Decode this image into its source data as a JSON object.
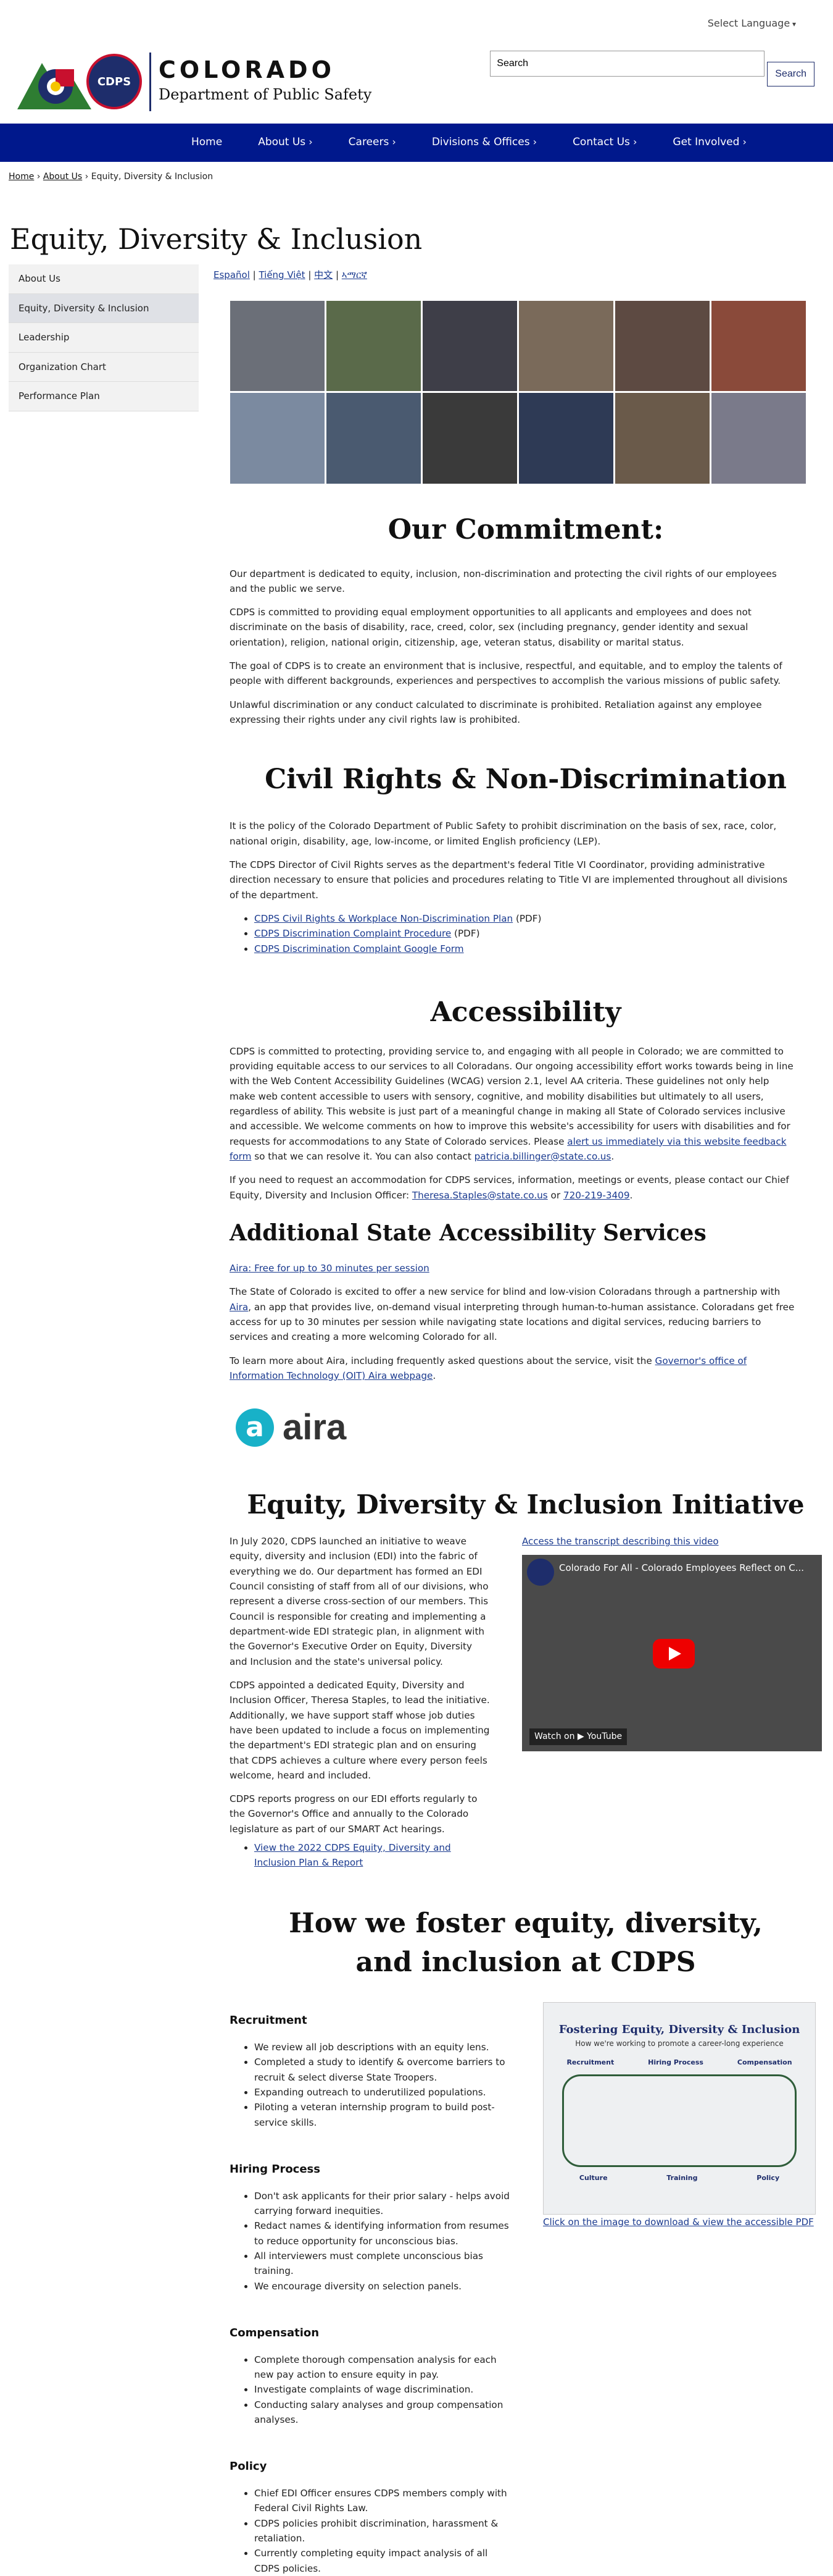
{
  "header": {
    "language_select": "Select Language",
    "logo_state": "COLORADO",
    "logo_dept": "Department of Public Safety",
    "logo_badge": "CDPS",
    "search_value": "Search",
    "search_button": "Search"
  },
  "nav": [
    "Home",
    "About Us",
    "Careers",
    "Divisions & Offices",
    "Contact Us",
    "Get Involved"
  ],
  "breadcrumb": {
    "home": "Home",
    "about": "About Us",
    "current": "Equity, Diversity & Inclusion"
  },
  "page_title": "Equity, Diversity & Inclusion",
  "sidebar": [
    "About Us",
    "Equity, Diversity & Inclusion",
    "Leadership",
    "Organization Chart",
    "Performance Plan"
  ],
  "languages": [
    "Español",
    "Tiếng Việt",
    "中文",
    "ኣማርኛ"
  ],
  "commitment": {
    "title": "Our Commitment:",
    "p1": "Our department is dedicated to equity, inclusion, non-discrimination and protecting the civil rights of our employees and the public we serve.",
    "p2": "CDPS is committed to providing equal employment opportunities to all applicants and employees and does not discriminate on the basis of disability, race, creed, color, sex (including pregnancy, gender identity and sexual orientation), religion, national origin, citizenship, age, veteran status, disability or marital status.",
    "p3": "The goal of CDPS is to create an environment that is inclusive, respectful, and equitable, and to employ the talents of people with different backgrounds, experiences and perspectives to accomplish the various missions of public safety.",
    "p4": "Unlawful discrimination or any conduct calculated to discriminate is prohibited. Retaliation against any employee expressing their rights under any civil rights law is prohibited."
  },
  "civil": {
    "title": "Civil Rights & Non-Discrimination",
    "p1": "It is the policy of the Colorado Department of Public Safety to prohibit discrimination on the basis of sex, race, color, national origin, disability, age, low-income, or limited English proficiency (LEP).",
    "p2": "The CDPS Director of Civil Rights serves as the department's federal Title VI Coordinator, providing administrative direction necessary to ensure that policies and procedures relating to Title VI are implemented throughout all divisions of the department.",
    "links": [
      {
        "text": "CDPS Civil Rights & Workplace Non-Discrimination Plan",
        "suffix": " (PDF)"
      },
      {
        "text": "CDPS Discrimination Complaint Procedure",
        "suffix": " (PDF)"
      },
      {
        "text": "CDPS Discrimination Complaint Google Form",
        "suffix": ""
      }
    ]
  },
  "access": {
    "title": "Accessibility",
    "p1a": "CDPS is committed to protecting, providing service to, and engaging with all people in Colorado; we are committed to providing equitable access to our services to all Coloradans. Our ongoing accessibility effort works towards being in line with the Web Content Accessibility Guidelines (WCAG) version 2.1, level AA criteria. These guidelines not only help make web content accessible to users with sensory, cognitive, and mobility disabilities but ultimately to all users, regardless of ability. This website is just part of a meaningful change in making all State of Colorado services inclusive and accessible. We welcome comments on how to improve this website's accessibility for users with disabilities and for requests for accommodations to any State of Colorado services. Please ",
    "p1link": "alert us immediately via this website feedback form",
    "p1b": " so that we can resolve it. You can also contact ",
    "p1email": "patricia.billinger@state.co.us",
    "p1c": ".",
    "p2a": "If you need to request an accommodation for CDPS services, information, meetings or events, please contact our Chief Equity, Diversity and Inclusion Officer: ",
    "p2email": "Theresa.Staples@state.co.us",
    "p2b": " or ",
    "p2phone": "720-219-3409",
    "p2c": "."
  },
  "additional": {
    "title": "Additional State Accessibility Services",
    "link": "Aira: Free for up to 30 minutes per session",
    "p1a": "The State of Colorado is excited to offer a new service for blind and low-vision Coloradans through a partnership with ",
    "p1link": "Aira",
    "p1b": ", an app that provides live, on-demand visual interpreting through human-to-human assistance. Coloradans get free access for up to 30 minutes per session while navigating state locations and digital services, reducing barriers to services and creating a more welcoming Colorado for all.",
    "p2a": "To learn more about Aira, including frequently asked questions about the service, visit the ",
    "p2link": "Governor's office of Information Technology (OIT) Aira webpage",
    "p2b": ".",
    "logo_letter": "a",
    "logo_word": "aira"
  },
  "initiative": {
    "title": "Equity, Diversity & Inclusion Initiative",
    "p1": "In July 2020, CDPS launched an initiative to weave equity, diversity and inclusion (EDI) into the fabric of everything we do. Our department has formed an EDI Council consisting of staff from all of our divisions, who represent a diverse cross-section of our members. This Council is responsible for creating and implementing a department-wide EDI strategic plan, in alignment with the Governor's Executive Order on Equity, Diversity and Inclusion and the state's universal policy.",
    "p2": "CDPS appointed a dedicated Equity, Diversity and Inclusion Officer, Theresa Staples, to lead the initiative. Additionally, we have support staff whose job duties have been updated to include a focus on implementing the department's EDI strategic plan and on ensuring that CDPS achieves a culture where every person feels welcome, heard and included.",
    "p3": "CDPS reports progress on our EDI efforts regularly to the Governor's Office and annually to the Colorado legislature as part of our SMART Act hearings.",
    "link": "View the 2022 CDPS Equity, Diversity and Inclusion Plan & Report",
    "transcript": "Access the transcript describing this video",
    "video_title": "Colorado For All - Colorado Employees Reflect on C...",
    "watch_on": "Watch on ▶ YouTube"
  },
  "foster": {
    "title": "How we foster equity, diversity, and inclusion at CDPS",
    "recruitment": {
      "title": "Recruitment",
      "items": [
        "We review all job descriptions with an equity lens.",
        "Completed a study to identify & overcome barriers to recruit & select diverse State Troopers.",
        "Expanding outreach to underutilized populations.",
        "Piloting a veteran internship program to build post-service skills."
      ]
    },
    "hiring": {
      "title": "Hiring Process",
      "items": [
        "Don't ask applicants for their prior salary - helps avoid carrying forward inequities.",
        "Redact names & identifying information from resumes to reduce opportunity for unconscious bias.",
        "All interviewers must complete unconscious bias training.",
        "We encourage diversity on selection panels."
      ]
    },
    "comp": {
      "title": "Compensation",
      "items": [
        "Complete thorough compensation analysis for each new pay action to ensure equity in pay.",
        "Investigate complaints of wage discrimination.",
        "Conducting salary analyses and group compensation analyses."
      ]
    },
    "policy": {
      "title": "Policy",
      "items": [
        "Chief EDI Officer ensures CDPS members comply with Federal Civil Rights Law.",
        "CDPS policies prohibit discrimination, harassment & retaliation.",
        "Currently completing equity impact analysis of all CDPS policies."
      ]
    },
    "infographic_title": "Fostering Equity, Diversity & Inclusion",
    "infographic_sub": "How we're working to promote a career-long experience",
    "infographic_cols": [
      "Recruitment",
      "Hiring Process",
      "Compensation"
    ],
    "infographic_cols2": [
      "Culture",
      "Training",
      "Policy"
    ],
    "infographic_link": "Click on the image to download & view the accessible PDF"
  }
}
